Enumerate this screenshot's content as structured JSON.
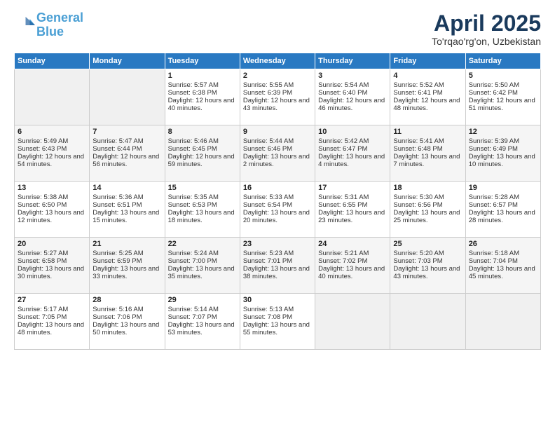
{
  "header": {
    "logo_line1": "General",
    "logo_line2": "Blue",
    "month_title": "April 2025",
    "location": "To'rqao'rg'on, Uzbekistan"
  },
  "weekdays": [
    "Sunday",
    "Monday",
    "Tuesday",
    "Wednesday",
    "Thursday",
    "Friday",
    "Saturday"
  ],
  "weeks": [
    [
      {
        "day": "",
        "empty": true
      },
      {
        "day": "",
        "empty": true
      },
      {
        "day": "1",
        "sunrise": "Sunrise: 5:57 AM",
        "sunset": "Sunset: 6:38 PM",
        "daylight": "Daylight: 12 hours and 40 minutes."
      },
      {
        "day": "2",
        "sunrise": "Sunrise: 5:55 AM",
        "sunset": "Sunset: 6:39 PM",
        "daylight": "Daylight: 12 hours and 43 minutes."
      },
      {
        "day": "3",
        "sunrise": "Sunrise: 5:54 AM",
        "sunset": "Sunset: 6:40 PM",
        "daylight": "Daylight: 12 hours and 46 minutes."
      },
      {
        "day": "4",
        "sunrise": "Sunrise: 5:52 AM",
        "sunset": "Sunset: 6:41 PM",
        "daylight": "Daylight: 12 hours and 48 minutes."
      },
      {
        "day": "5",
        "sunrise": "Sunrise: 5:50 AM",
        "sunset": "Sunset: 6:42 PM",
        "daylight": "Daylight: 12 hours and 51 minutes."
      }
    ],
    [
      {
        "day": "6",
        "sunrise": "Sunrise: 5:49 AM",
        "sunset": "Sunset: 6:43 PM",
        "daylight": "Daylight: 12 hours and 54 minutes."
      },
      {
        "day": "7",
        "sunrise": "Sunrise: 5:47 AM",
        "sunset": "Sunset: 6:44 PM",
        "daylight": "Daylight: 12 hours and 56 minutes."
      },
      {
        "day": "8",
        "sunrise": "Sunrise: 5:46 AM",
        "sunset": "Sunset: 6:45 PM",
        "daylight": "Daylight: 12 hours and 59 minutes."
      },
      {
        "day": "9",
        "sunrise": "Sunrise: 5:44 AM",
        "sunset": "Sunset: 6:46 PM",
        "daylight": "Daylight: 13 hours and 2 minutes."
      },
      {
        "day": "10",
        "sunrise": "Sunrise: 5:42 AM",
        "sunset": "Sunset: 6:47 PM",
        "daylight": "Daylight: 13 hours and 4 minutes."
      },
      {
        "day": "11",
        "sunrise": "Sunrise: 5:41 AM",
        "sunset": "Sunset: 6:48 PM",
        "daylight": "Daylight: 13 hours and 7 minutes."
      },
      {
        "day": "12",
        "sunrise": "Sunrise: 5:39 AM",
        "sunset": "Sunset: 6:49 PM",
        "daylight": "Daylight: 13 hours and 10 minutes."
      }
    ],
    [
      {
        "day": "13",
        "sunrise": "Sunrise: 5:38 AM",
        "sunset": "Sunset: 6:50 PM",
        "daylight": "Daylight: 13 hours and 12 minutes."
      },
      {
        "day": "14",
        "sunrise": "Sunrise: 5:36 AM",
        "sunset": "Sunset: 6:51 PM",
        "daylight": "Daylight: 13 hours and 15 minutes."
      },
      {
        "day": "15",
        "sunrise": "Sunrise: 5:35 AM",
        "sunset": "Sunset: 6:53 PM",
        "daylight": "Daylight: 13 hours and 18 minutes."
      },
      {
        "day": "16",
        "sunrise": "Sunrise: 5:33 AM",
        "sunset": "Sunset: 6:54 PM",
        "daylight": "Daylight: 13 hours and 20 minutes."
      },
      {
        "day": "17",
        "sunrise": "Sunrise: 5:31 AM",
        "sunset": "Sunset: 6:55 PM",
        "daylight": "Daylight: 13 hours and 23 minutes."
      },
      {
        "day": "18",
        "sunrise": "Sunrise: 5:30 AM",
        "sunset": "Sunset: 6:56 PM",
        "daylight": "Daylight: 13 hours and 25 minutes."
      },
      {
        "day": "19",
        "sunrise": "Sunrise: 5:28 AM",
        "sunset": "Sunset: 6:57 PM",
        "daylight": "Daylight: 13 hours and 28 minutes."
      }
    ],
    [
      {
        "day": "20",
        "sunrise": "Sunrise: 5:27 AM",
        "sunset": "Sunset: 6:58 PM",
        "daylight": "Daylight: 13 hours and 30 minutes."
      },
      {
        "day": "21",
        "sunrise": "Sunrise: 5:25 AM",
        "sunset": "Sunset: 6:59 PM",
        "daylight": "Daylight: 13 hours and 33 minutes."
      },
      {
        "day": "22",
        "sunrise": "Sunrise: 5:24 AM",
        "sunset": "Sunset: 7:00 PM",
        "daylight": "Daylight: 13 hours and 35 minutes."
      },
      {
        "day": "23",
        "sunrise": "Sunrise: 5:23 AM",
        "sunset": "Sunset: 7:01 PM",
        "daylight": "Daylight: 13 hours and 38 minutes."
      },
      {
        "day": "24",
        "sunrise": "Sunrise: 5:21 AM",
        "sunset": "Sunset: 7:02 PM",
        "daylight": "Daylight: 13 hours and 40 minutes."
      },
      {
        "day": "25",
        "sunrise": "Sunrise: 5:20 AM",
        "sunset": "Sunset: 7:03 PM",
        "daylight": "Daylight: 13 hours and 43 minutes."
      },
      {
        "day": "26",
        "sunrise": "Sunrise: 5:18 AM",
        "sunset": "Sunset: 7:04 PM",
        "daylight": "Daylight: 13 hours and 45 minutes."
      }
    ],
    [
      {
        "day": "27",
        "sunrise": "Sunrise: 5:17 AM",
        "sunset": "Sunset: 7:05 PM",
        "daylight": "Daylight: 13 hours and 48 minutes."
      },
      {
        "day": "28",
        "sunrise": "Sunrise: 5:16 AM",
        "sunset": "Sunset: 7:06 PM",
        "daylight": "Daylight: 13 hours and 50 minutes."
      },
      {
        "day": "29",
        "sunrise": "Sunrise: 5:14 AM",
        "sunset": "Sunset: 7:07 PM",
        "daylight": "Daylight: 13 hours and 53 minutes."
      },
      {
        "day": "30",
        "sunrise": "Sunrise: 5:13 AM",
        "sunset": "Sunset: 7:08 PM",
        "daylight": "Daylight: 13 hours and 55 minutes."
      },
      {
        "day": "",
        "empty": true
      },
      {
        "day": "",
        "empty": true
      },
      {
        "day": "",
        "empty": true
      }
    ]
  ]
}
